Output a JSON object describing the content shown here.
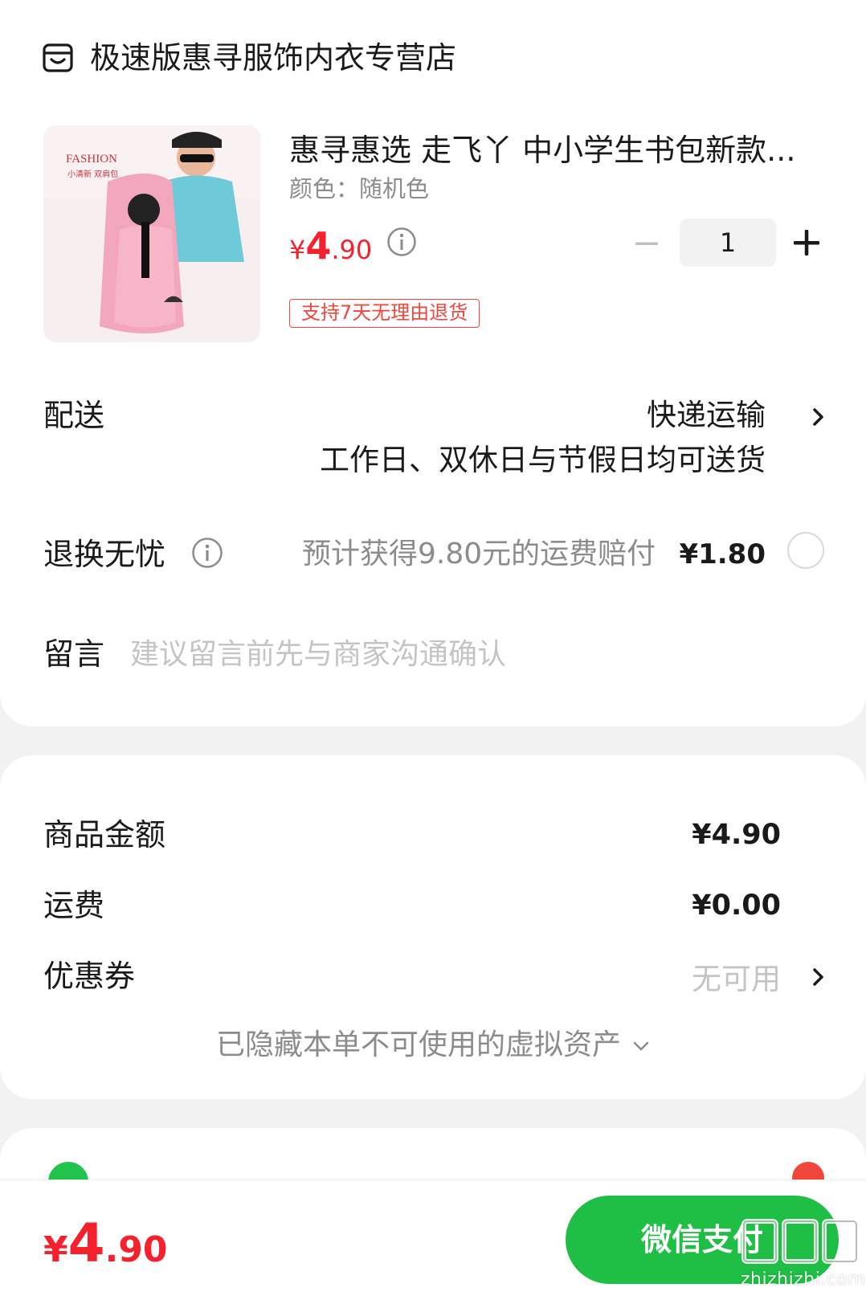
{
  "store": {
    "name": "极速版惠寻服饰内衣专营店",
    "icon": "store-icon"
  },
  "product": {
    "title": "惠寻惠选 走飞丫 中小学生书包新款...",
    "spec": "颜色：随机色",
    "price_symbol": "¥",
    "price_int": "4",
    "price_dec": ".90",
    "quantity": "1",
    "return_tag": "支持7天无理由退货",
    "image_text_brand": "FASHION",
    "image_text_sub": "小清新 双肩包"
  },
  "delivery": {
    "label": "配送",
    "method": "快递运输",
    "note": "工作日、双休日与节假日均可送货"
  },
  "return_service": {
    "label": "退换无忧",
    "desc": "预计获得9.80元的运费赔付",
    "amount": "¥1.80"
  },
  "message": {
    "label": "留言",
    "placeholder": "建议留言前先与商家沟通确认"
  },
  "summary": {
    "goods_label": "商品金额",
    "goods_value": "¥4.90",
    "shipping_label": "运费",
    "shipping_value": "¥0.00",
    "coupon_label": "优惠券",
    "coupon_value": "无可用",
    "hidden_assets": "已隐藏本单不可使用的虚拟资产"
  },
  "footer": {
    "total_symbol": "¥",
    "total_int": "4",
    "total_dec": ".90",
    "pay_label": "微信支付",
    "watermark": "zhizhizhi.com"
  },
  "colors": {
    "price_red": "#f5222d",
    "pay_green": "#1fbf45",
    "tag_red": "#f0463c"
  }
}
